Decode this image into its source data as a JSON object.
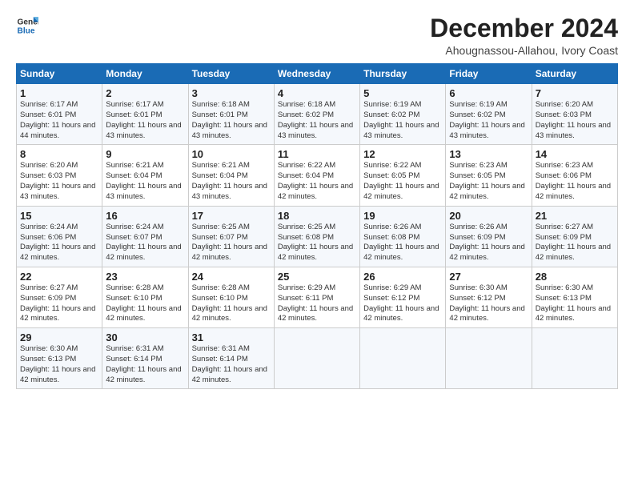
{
  "logo": {
    "general": "General",
    "blue": "Blue"
  },
  "header": {
    "title": "December 2024",
    "subtitle": "Ahougnassou-Allahou, Ivory Coast"
  },
  "days_of_week": [
    "Sunday",
    "Monday",
    "Tuesday",
    "Wednesday",
    "Thursday",
    "Friday",
    "Saturday"
  ],
  "weeks": [
    {
      "days": [
        {
          "num": "1",
          "sunrise": "Sunrise: 6:17 AM",
          "sunset": "Sunset: 6:01 PM",
          "daylight": "Daylight: 11 hours and 44 minutes."
        },
        {
          "num": "2",
          "sunrise": "Sunrise: 6:17 AM",
          "sunset": "Sunset: 6:01 PM",
          "daylight": "Daylight: 11 hours and 43 minutes."
        },
        {
          "num": "3",
          "sunrise": "Sunrise: 6:18 AM",
          "sunset": "Sunset: 6:01 PM",
          "daylight": "Daylight: 11 hours and 43 minutes."
        },
        {
          "num": "4",
          "sunrise": "Sunrise: 6:18 AM",
          "sunset": "Sunset: 6:02 PM",
          "daylight": "Daylight: 11 hours and 43 minutes."
        },
        {
          "num": "5",
          "sunrise": "Sunrise: 6:19 AM",
          "sunset": "Sunset: 6:02 PM",
          "daylight": "Daylight: 11 hours and 43 minutes."
        },
        {
          "num": "6",
          "sunrise": "Sunrise: 6:19 AM",
          "sunset": "Sunset: 6:02 PM",
          "daylight": "Daylight: 11 hours and 43 minutes."
        },
        {
          "num": "7",
          "sunrise": "Sunrise: 6:20 AM",
          "sunset": "Sunset: 6:03 PM",
          "daylight": "Daylight: 11 hours and 43 minutes."
        }
      ]
    },
    {
      "days": [
        {
          "num": "8",
          "sunrise": "Sunrise: 6:20 AM",
          "sunset": "Sunset: 6:03 PM",
          "daylight": "Daylight: 11 hours and 43 minutes."
        },
        {
          "num": "9",
          "sunrise": "Sunrise: 6:21 AM",
          "sunset": "Sunset: 6:04 PM",
          "daylight": "Daylight: 11 hours and 43 minutes."
        },
        {
          "num": "10",
          "sunrise": "Sunrise: 6:21 AM",
          "sunset": "Sunset: 6:04 PM",
          "daylight": "Daylight: 11 hours and 43 minutes."
        },
        {
          "num": "11",
          "sunrise": "Sunrise: 6:22 AM",
          "sunset": "Sunset: 6:04 PM",
          "daylight": "Daylight: 11 hours and 42 minutes."
        },
        {
          "num": "12",
          "sunrise": "Sunrise: 6:22 AM",
          "sunset": "Sunset: 6:05 PM",
          "daylight": "Daylight: 11 hours and 42 minutes."
        },
        {
          "num": "13",
          "sunrise": "Sunrise: 6:23 AM",
          "sunset": "Sunset: 6:05 PM",
          "daylight": "Daylight: 11 hours and 42 minutes."
        },
        {
          "num": "14",
          "sunrise": "Sunrise: 6:23 AM",
          "sunset": "Sunset: 6:06 PM",
          "daylight": "Daylight: 11 hours and 42 minutes."
        }
      ]
    },
    {
      "days": [
        {
          "num": "15",
          "sunrise": "Sunrise: 6:24 AM",
          "sunset": "Sunset: 6:06 PM",
          "daylight": "Daylight: 11 hours and 42 minutes."
        },
        {
          "num": "16",
          "sunrise": "Sunrise: 6:24 AM",
          "sunset": "Sunset: 6:07 PM",
          "daylight": "Daylight: 11 hours and 42 minutes."
        },
        {
          "num": "17",
          "sunrise": "Sunrise: 6:25 AM",
          "sunset": "Sunset: 6:07 PM",
          "daylight": "Daylight: 11 hours and 42 minutes."
        },
        {
          "num": "18",
          "sunrise": "Sunrise: 6:25 AM",
          "sunset": "Sunset: 6:08 PM",
          "daylight": "Daylight: 11 hours and 42 minutes."
        },
        {
          "num": "19",
          "sunrise": "Sunrise: 6:26 AM",
          "sunset": "Sunset: 6:08 PM",
          "daylight": "Daylight: 11 hours and 42 minutes."
        },
        {
          "num": "20",
          "sunrise": "Sunrise: 6:26 AM",
          "sunset": "Sunset: 6:09 PM",
          "daylight": "Daylight: 11 hours and 42 minutes."
        },
        {
          "num": "21",
          "sunrise": "Sunrise: 6:27 AM",
          "sunset": "Sunset: 6:09 PM",
          "daylight": "Daylight: 11 hours and 42 minutes."
        }
      ]
    },
    {
      "days": [
        {
          "num": "22",
          "sunrise": "Sunrise: 6:27 AM",
          "sunset": "Sunset: 6:09 PM",
          "daylight": "Daylight: 11 hours and 42 minutes."
        },
        {
          "num": "23",
          "sunrise": "Sunrise: 6:28 AM",
          "sunset": "Sunset: 6:10 PM",
          "daylight": "Daylight: 11 hours and 42 minutes."
        },
        {
          "num": "24",
          "sunrise": "Sunrise: 6:28 AM",
          "sunset": "Sunset: 6:10 PM",
          "daylight": "Daylight: 11 hours and 42 minutes."
        },
        {
          "num": "25",
          "sunrise": "Sunrise: 6:29 AM",
          "sunset": "Sunset: 6:11 PM",
          "daylight": "Daylight: 11 hours and 42 minutes."
        },
        {
          "num": "26",
          "sunrise": "Sunrise: 6:29 AM",
          "sunset": "Sunset: 6:12 PM",
          "daylight": "Daylight: 11 hours and 42 minutes."
        },
        {
          "num": "27",
          "sunrise": "Sunrise: 6:30 AM",
          "sunset": "Sunset: 6:12 PM",
          "daylight": "Daylight: 11 hours and 42 minutes."
        },
        {
          "num": "28",
          "sunrise": "Sunrise: 6:30 AM",
          "sunset": "Sunset: 6:13 PM",
          "daylight": "Daylight: 11 hours and 42 minutes."
        }
      ]
    },
    {
      "days": [
        {
          "num": "29",
          "sunrise": "Sunrise: 6:30 AM",
          "sunset": "Sunset: 6:13 PM",
          "daylight": "Daylight: 11 hours and 42 minutes."
        },
        {
          "num": "30",
          "sunrise": "Sunrise: 6:31 AM",
          "sunset": "Sunset: 6:14 PM",
          "daylight": "Daylight: 11 hours and 42 minutes."
        },
        {
          "num": "31",
          "sunrise": "Sunrise: 6:31 AM",
          "sunset": "Sunset: 6:14 PM",
          "daylight": "Daylight: 11 hours and 42 minutes."
        },
        null,
        null,
        null,
        null
      ]
    }
  ]
}
